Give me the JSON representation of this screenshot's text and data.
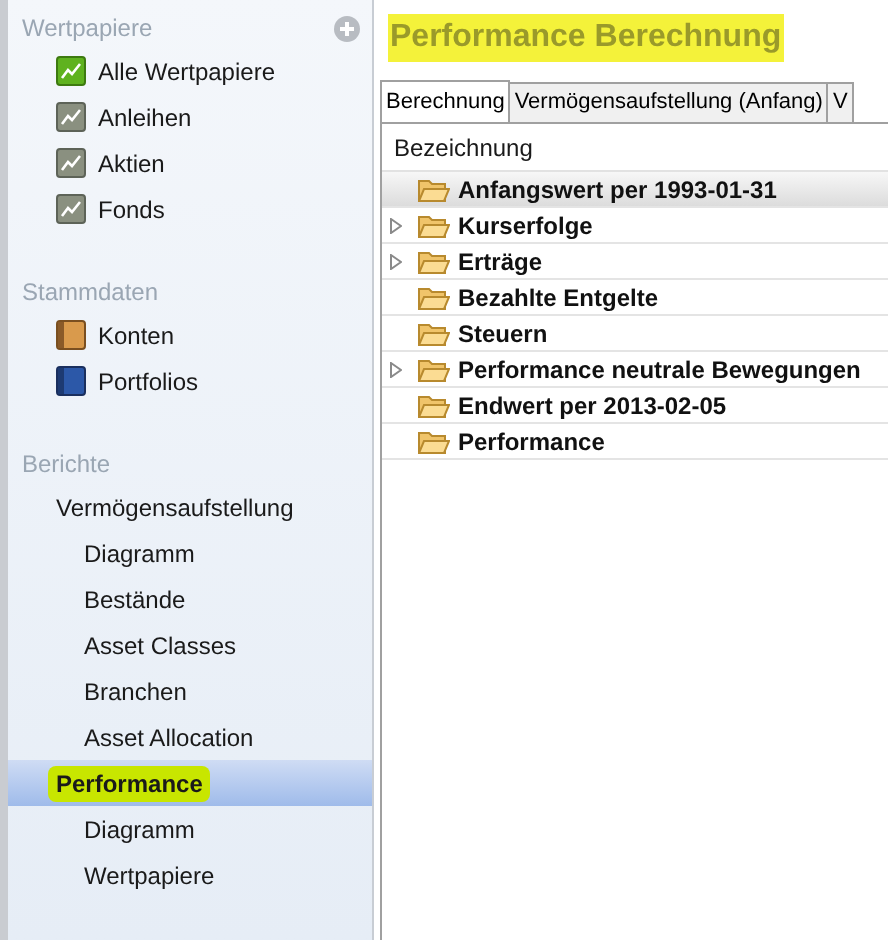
{
  "sidebar": {
    "sections": [
      {
        "title": "Wertpapiere",
        "add_button": true,
        "items": [
          {
            "label": "Alle Wertpapiere",
            "kind": "chart-active",
            "selected": false,
            "highlighted": false
          },
          {
            "label": "Anleihen",
            "kind": "chart",
            "selected": false,
            "highlighted": false
          },
          {
            "label": "Aktien",
            "kind": "chart",
            "selected": false,
            "highlighted": false
          },
          {
            "label": "Fonds",
            "kind": "chart",
            "selected": false,
            "highlighted": false
          }
        ]
      },
      {
        "title": "Stammdaten",
        "items": [
          {
            "label": "Konten",
            "kind": "account",
            "selected": false,
            "highlighted": false
          },
          {
            "label": "Portfolios",
            "kind": "portfolio",
            "selected": false,
            "highlighted": false
          }
        ]
      },
      {
        "title": "Berichte",
        "items": [
          {
            "label": "Vermögensaufstellung",
            "kind": "report",
            "selected": false,
            "highlighted": false,
            "children": [
              {
                "label": "Diagramm",
                "selected": false
              },
              {
                "label": "Bestände",
                "selected": false
              },
              {
                "label": "Asset Classes",
                "selected": false
              },
              {
                "label": "Branchen",
                "selected": false
              },
              {
                "label": "Asset Allocation",
                "selected": false
              }
            ]
          },
          {
            "label": "Performance",
            "kind": "report",
            "selected": true,
            "highlighted": true,
            "children": [
              {
                "label": "Diagramm",
                "selected": false
              },
              {
                "label": "Wertpapiere",
                "selected": false
              }
            ]
          }
        ]
      }
    ]
  },
  "main": {
    "title": "Performance Berechnung",
    "title_highlighted": true,
    "tabs": [
      {
        "label": "Berechnung",
        "selected": true
      },
      {
        "label": "Vermögensaufstellung (Anfang)",
        "selected": false
      },
      {
        "label": "V",
        "selected": false
      }
    ],
    "tree": {
      "columns": [
        "Bezeichnung"
      ],
      "rows": [
        {
          "label": "Anfangswert per 1993-01-31",
          "expandable": false,
          "selected": true
        },
        {
          "label": "Kurserfolge",
          "expandable": true,
          "selected": false
        },
        {
          "label": "Erträge",
          "expandable": true,
          "selected": false
        },
        {
          "label": "Bezahlte Entgelte",
          "expandable": false,
          "selected": false
        },
        {
          "label": "Steuern",
          "expandable": false,
          "selected": false
        },
        {
          "label": "Performance neutrale Bewegungen",
          "expandable": true,
          "selected": false
        },
        {
          "label": "Endwert per 2013-02-05",
          "expandable": false,
          "selected": false
        },
        {
          "label": "Performance",
          "expandable": false,
          "selected": false
        }
      ]
    }
  }
}
